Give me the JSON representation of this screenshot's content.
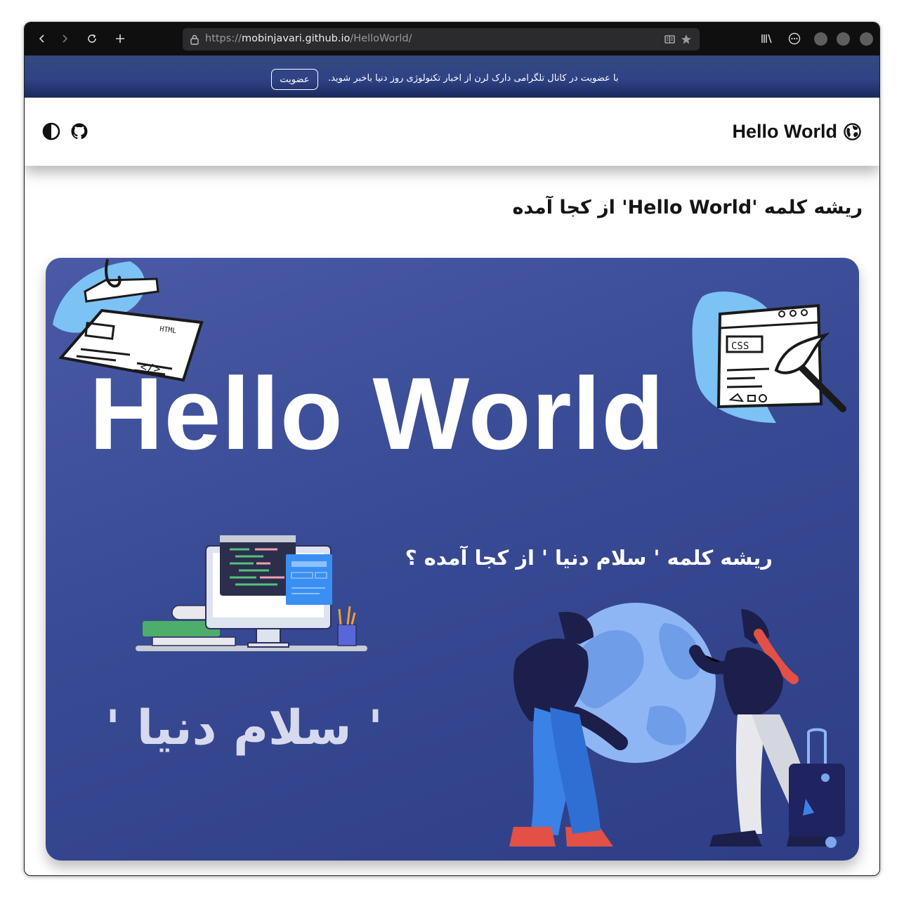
{
  "browser": {
    "url_scheme": "https://",
    "url_host": "mobinjavari.github.io",
    "url_path": "/HelloWorld/"
  },
  "announcement": {
    "text": "با عضویت در کانال تلگرامی دارک لرن از اخبار تکنولوژی روز دنیا باخبر شوید.",
    "join_label": "عضویت"
  },
  "header": {
    "brand_title": "Hello World",
    "brand_icon": "globe-icon",
    "actions": [
      "theme-toggle-icon",
      "github-icon"
    ]
  },
  "main": {
    "title": "ریشه کلمه 'Hello World' از کجا آمده"
  },
  "hero": {
    "title": "Hello World",
    "question": "ریشه کلمه ' سلام دنیا '  از کجا آمده ؟",
    "greeting": "' سلام دنیا '",
    "sticker_html": "HTML",
    "sticker_code": "</>",
    "sticker_css": "CSS"
  },
  "colors": {
    "hero_bg": "#3a4b95",
    "announce_bg": "#2f4386",
    "accent_blue": "#7aa7f0"
  }
}
